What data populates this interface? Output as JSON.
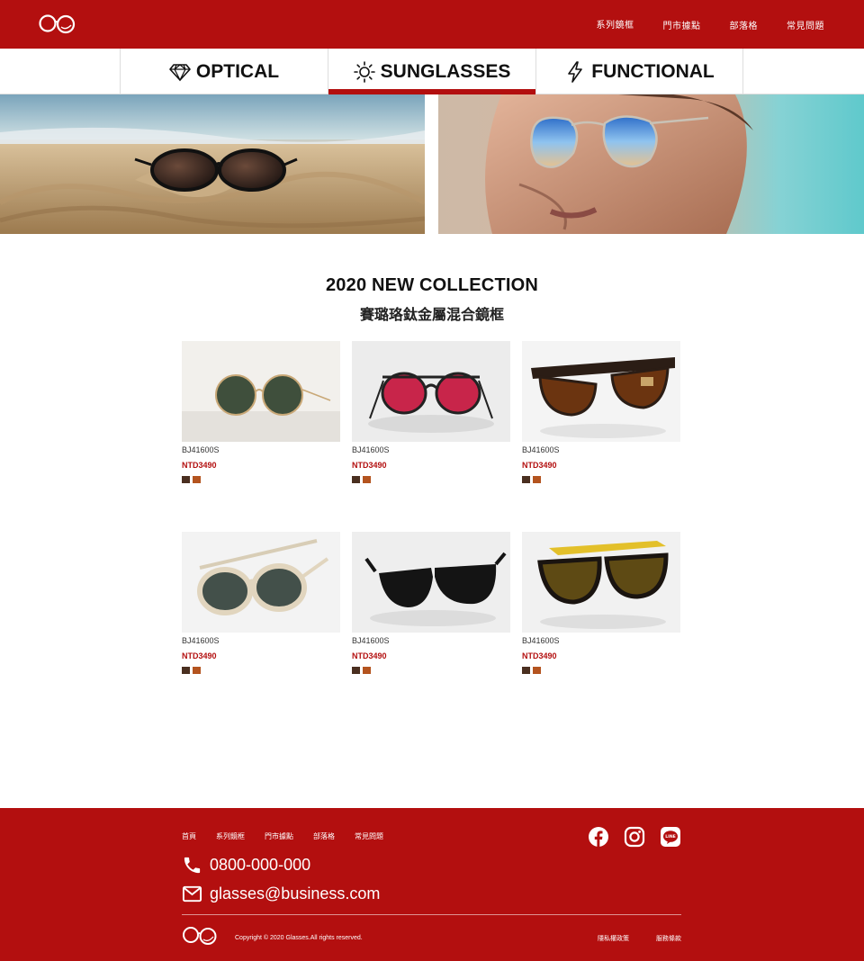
{
  "header": {
    "nav": [
      "系列鏡框",
      "門市據點",
      "部落格",
      "常見問題"
    ]
  },
  "tabs": [
    {
      "label": "OPTICAL",
      "icon": "diamond-icon",
      "active": false
    },
    {
      "label": "SUNGLASSES",
      "icon": "sun-icon",
      "active": true
    },
    {
      "label": "FUNCTIONAL",
      "icon": "lightning-icon",
      "active": false
    }
  ],
  "collection": {
    "title": "2020 NEW COLLECTION",
    "subtitle": "賽璐珞鈦金屬混合鏡框"
  },
  "products": [
    {
      "code": "BJ41600S",
      "price": "NTD3490",
      "swatches": [
        "#4a2f20",
        "#b4541f"
      ]
    },
    {
      "code": "BJ41600S",
      "price": "NTD3490",
      "swatches": [
        "#4a2f20",
        "#b4541f"
      ]
    },
    {
      "code": "BJ41600S",
      "price": "NTD3490",
      "swatches": [
        "#4a2f20",
        "#b4541f"
      ]
    },
    {
      "code": "BJ41600S",
      "price": "NTD3490",
      "swatches": [
        "#4a2f20",
        "#b4541f"
      ]
    },
    {
      "code": "BJ41600S",
      "price": "NTD3490",
      "swatches": [
        "#4a2f20",
        "#b4541f"
      ]
    },
    {
      "code": "BJ41600S",
      "price": "NTD3490",
      "swatches": [
        "#4a2f20",
        "#b4541f"
      ]
    }
  ],
  "footer": {
    "nav": [
      "首頁",
      "系列鏡框",
      "門市據點",
      "部落格",
      "常見問題"
    ],
    "phone": "0800-000-000",
    "email": "glasses@business.com",
    "copyright": "Copyright © 2020 Glasses.All rights reserved.",
    "links": [
      "隱私權政策",
      "服務條款"
    ],
    "social": [
      "facebook-icon",
      "instagram-icon",
      "line-icon"
    ]
  },
  "colors": {
    "brand": "#b30f0f",
    "price": "#b30f0f"
  }
}
